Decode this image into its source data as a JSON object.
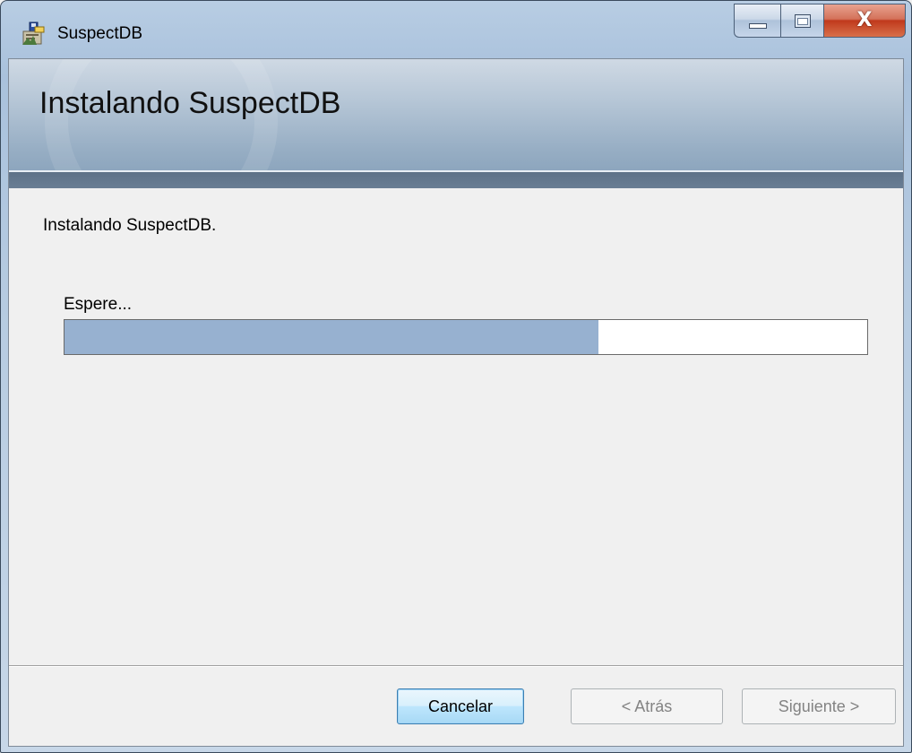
{
  "window": {
    "title": "SuspectDB",
    "app_icon": "installer-icon",
    "caption_buttons": {
      "minimize_icon": "minimize-icon",
      "maximize_icon": "maximize-icon",
      "close_icon": "close-icon",
      "close_glyph": "X"
    }
  },
  "banner": {
    "title": "Instalando SuspectDB"
  },
  "body": {
    "status_text": "Instalando SuspectDB.",
    "wait_label": "Espere...",
    "progress_fraction": 0.665
  },
  "footer": {
    "cancel_label": "Cancelar",
    "back_label": "< Atrás",
    "next_label": "Siguiente >"
  },
  "colors": {
    "progress_fill": "#97b1d0",
    "banner_band": "#5d7187",
    "close_button": "#c0391c",
    "default_button_border": "#3c7fb1",
    "disabled_text": "#838383"
  }
}
